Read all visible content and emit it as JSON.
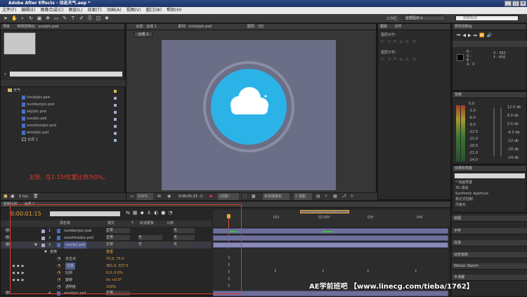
{
  "window": {
    "title": "Adobe After Effects - 动态天气.aep *"
  },
  "menu": [
    "文件(F)",
    "编辑(E)",
    "图像合成(C)",
    "图层(L)",
    "效果(T)",
    "动画(A)",
    "视图(V)",
    "窗口(W)",
    "帮助(H)"
  ],
  "workspace": {
    "label": "工作区：",
    "value": "全部显示"
  },
  "search": {
    "placeholder": "搜索帮助"
  },
  "project": {
    "tab": "项目",
    "effects_tab": "特效控制台：sun/pic.psd",
    "folder": "天气",
    "files": [
      "circle/pic.psd",
      "number/pic.psd",
      "sky/pic.psd",
      "sun/pic.psd",
      "sunshine/pic.psd",
      "wind/pic.psd"
    ],
    "comp_item": "合成 1",
    "bpc": "8 bpc"
  },
  "annotation": {
    "text": "太阳，在1:15f位置比例为0%。"
  },
  "viewer": {
    "tabs": [
      "合成：合成 1",
      "素材：circle/pic.psd",
      "图层：(无)"
    ],
    "comp_tab": "合成 1",
    "zoom": "100%",
    "timecode": "0;00;01;15",
    "resolution": "(完整)",
    "camera": "有效摄像机",
    "views": "1 视图"
  },
  "right": {
    "tracker_tab": "跟踪",
    "align_tab": "对齐",
    "align_layer": "图层对齐：",
    "distribute": "图层分布：",
    "preview_tab": "预览控制台",
    "info": {
      "r": "R :",
      "g": "G :",
      "b": "B :",
      "a": "A : 0",
      "x": "X : 362",
      "y": "Y : 450"
    },
    "audio_tab": "音频",
    "audio_scale": [
      "0.0",
      "-3.0",
      "-6.0",
      "-9.0",
      "-12.0",
      "-15.0",
      "-18.0",
      "-21.0",
      "-24.0"
    ],
    "audio_db": [
      "12.0 db",
      "6.0 db",
      "0.0 db",
      "-6.0 db",
      "-12 db",
      "-18 db",
      "-24 db"
    ],
    "effects_panel_tab": "效果和预置",
    "effects_items": [
      "* 动画预置",
      "3D 通道",
      "Synthetic Aperture",
      "表达式控制",
      "风格化"
    ],
    "lower_tabs": [
      "绘图",
      "字符",
      "段落",
      "动态笔刷",
      "Motion Sketch",
      "平滑器"
    ]
  },
  "timeline": {
    "tabs": [
      "渲染队列",
      "合成 1"
    ],
    "timecode": "0:00:01:15",
    "columns": [
      "源名称",
      "模式",
      "T",
      "轨道蒙板",
      "父级"
    ],
    "ruler": [
      "01f",
      "02:00f",
      "03f",
      "04f"
    ],
    "layers": [
      {
        "num": "1",
        "name": "number/pic.psd",
        "mode": "正常",
        "track": "",
        "parent": "无"
      },
      {
        "num": "2",
        "name": "sunshine/pic.psd",
        "mode": "正常",
        "track": "无",
        "parent": "无"
      },
      {
        "num": "3",
        "name": "sun/pic.psd",
        "mode": "正常",
        "track": "无",
        "parent": "无"
      },
      {
        "num": "4",
        "name": "wind/pic.psd",
        "mode": "正常",
        "track": "",
        "parent": "无"
      }
    ],
    "transform": {
      "label": "变换",
      "reset": "重置"
    },
    "props": [
      {
        "name": "定位点",
        "value": "75.0, 75.0"
      },
      {
        "name": "位置",
        "value": "361.0, 337.5"
      },
      {
        "name": "比例",
        "value": "0.0, 0.0%"
      },
      {
        "name": "旋转",
        "value": "0x +0.0°"
      },
      {
        "name": "透明度",
        "value": "100%"
      }
    ]
  },
  "watermark": {
    "text": "AE学前班吧 【www.linecg.com/tieba/1762】"
  },
  "colors": {
    "accent": "#e8a33a",
    "sun_blue": "#2bb3e8",
    "comp_bg": "#6b6e86",
    "annotation": "#e23a2a"
  }
}
